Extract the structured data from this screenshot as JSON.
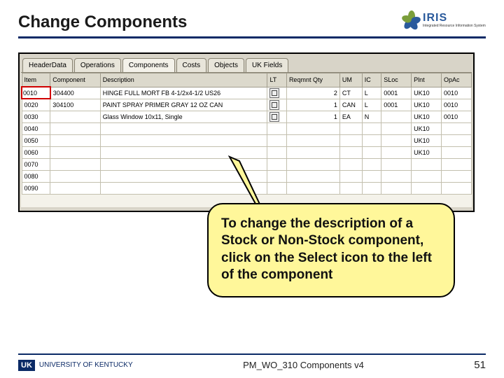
{
  "title": "Change Components",
  "logo": {
    "text": "IRIS",
    "sub": "Integrated Resource Information System"
  },
  "tabs": [
    "HeaderData",
    "Operations",
    "Components",
    "Costs",
    "Objects",
    "UK Fields"
  ],
  "grid": {
    "cols": [
      "Item",
      "Component",
      "Description",
      "LT",
      "Reqmnt Qty",
      "UM",
      "IC",
      "SLoc",
      "Plnt",
      "OpAc"
    ],
    "rows": [
      {
        "item": "0010",
        "comp": "304400",
        "desc": "HINGE FULL MORT FB 4-1/2x4-1/2 US26",
        "qty": "2",
        "um": "CT",
        "ic": "L",
        "sloc": "0001",
        "plnt": "UK10",
        "opac": "0010"
      },
      {
        "item": "0020",
        "comp": "304100",
        "desc": "PAINT SPRAY PRIMER GRAY 12 OZ CAN",
        "qty": "1",
        "um": "CAN",
        "ic": "L",
        "sloc": "0001",
        "plnt": "UK10",
        "opac": "0010"
      },
      {
        "item": "0030",
        "comp": "",
        "desc": "Glass Window 10x11, Single",
        "qty": "1",
        "um": "EA",
        "ic": "N",
        "sloc": "",
        "plnt": "UK10",
        "opac": "0010"
      },
      {
        "item": "0040",
        "plnt": "UK10"
      },
      {
        "item": "0050",
        "plnt": "UK10"
      },
      {
        "item": "0060",
        "plnt": "UK10"
      },
      {
        "item": "0070",
        "plnt": ""
      },
      {
        "item": "0080"
      },
      {
        "item": "0090"
      }
    ]
  },
  "callout": "To change the description of a Stock or Non-Stock component, click on the Select icon to the left of the component",
  "footer": {
    "uk_mark": "UK",
    "uk_name": "UNIVERSITY OF KENTUCKY",
    "center": "PM_WO_310 Components v4",
    "page": "51"
  }
}
